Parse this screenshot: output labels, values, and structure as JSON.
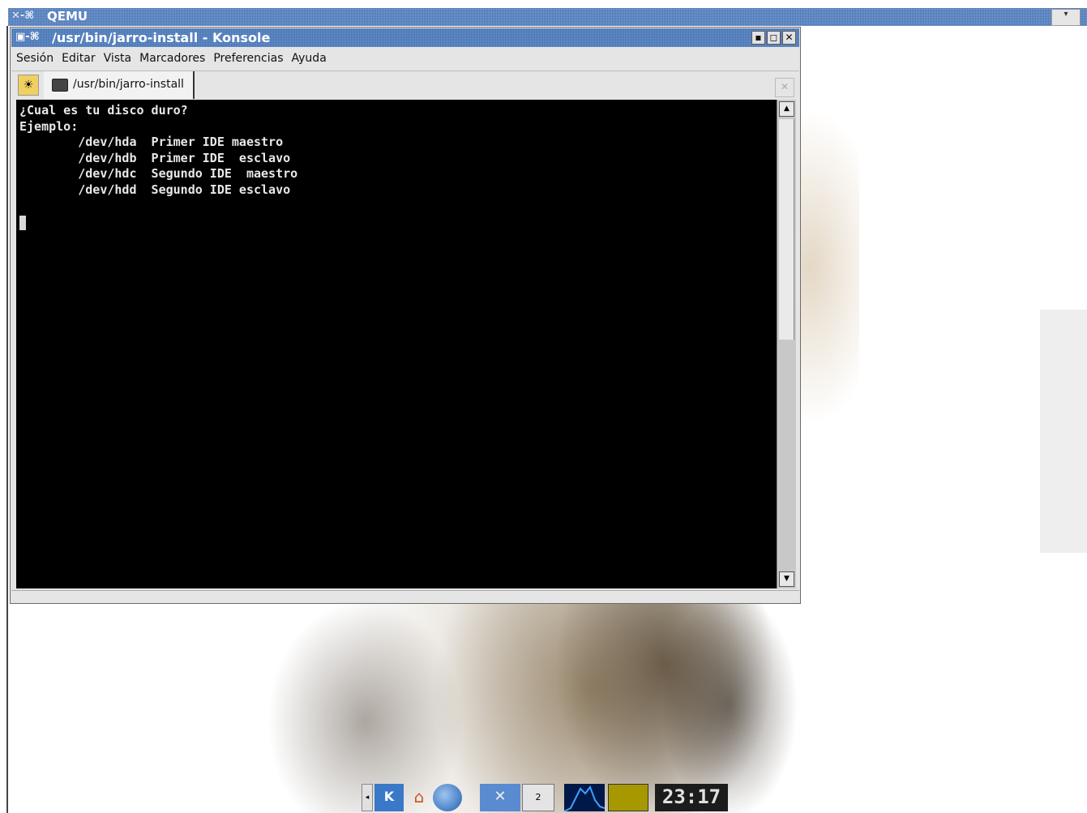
{
  "qemu": {
    "title": "QEMU",
    "icon": "xbutton-pin-icon",
    "menu_icon": "▾"
  },
  "window": {
    "title": "/usr/bin/jarro-install - Konsole",
    "buttons": {
      "minimize": "▪",
      "maximize": "◻",
      "close": "✕"
    }
  },
  "menubar": {
    "items": [
      "Sesión",
      "Editar",
      "Vista",
      "Marcadores",
      "Preferencias",
      "Ayuda"
    ]
  },
  "tabs": [
    {
      "label": "/usr/bin/jarro-install",
      "icon": "terminal-icon"
    }
  ],
  "terminal": {
    "lines": [
      "¿Cual es tu disco duro?",
      "Ejemplo:",
      "        /dev/hda  Primer IDE maestro",
      "        /dev/hdb  Primer IDE  esclavo",
      "        /dev/hdc  Segundo IDE  maestro",
      "        /dev/hdd  Segundo IDE esclavo"
    ]
  },
  "taskbar": {
    "kmenu_label": "K",
    "clock": "23:17",
    "pager_label": "2"
  },
  "colors": {
    "titlebar": "#3b6cb3",
    "terminal_bg": "#000000",
    "terminal_fg": "#e8e8e8"
  }
}
